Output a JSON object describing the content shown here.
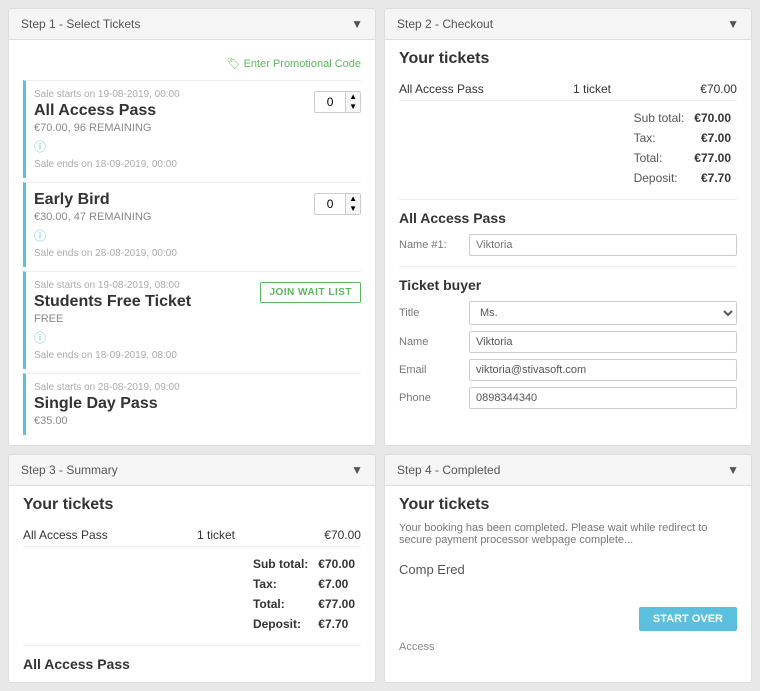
{
  "step1": {
    "header": "Step 1 - Select Tickets",
    "promo_label": "Enter Promotional Code",
    "tickets": [
      {
        "sale_start": "Sale starts on 19-08-2019, 00:00",
        "name": "All Access Pass",
        "price": "€70.00, 96 REMAINING",
        "sale_end": "Sale ends on 18-09-2019, 00:00",
        "qty": "0",
        "type": "qty"
      },
      {
        "sale_start": "",
        "name": "Early Bird",
        "price": "€30.00, 47 REMAINING",
        "sale_end": "Sale ends on 28-08-2019, 00:00",
        "qty": "0",
        "type": "qty"
      },
      {
        "sale_start": "Sale starts on 19-08-2019, 08:00",
        "name": "Students Free Ticket",
        "price": "FREE",
        "sale_end": "Sale ends on 18-09-2019, 08:00",
        "qty": "",
        "type": "waitlist",
        "waitlist_label": "JOIN WAIT LIST"
      },
      {
        "sale_start": "Sale starts on 28-08-2019, 09:00",
        "name": "Single Day Pass",
        "price": "€35.00",
        "sale_end": "",
        "qty": "",
        "type": "none"
      }
    ]
  },
  "step2": {
    "header": "Step 2 - Checkout",
    "your_tickets": "Your tickets",
    "ticket_name": "All Access Pass",
    "ticket_count": "1 ticket",
    "ticket_price": "€70.00",
    "sub_total_label": "Sub total:",
    "sub_total_value": "€70.00",
    "tax_label": "Tax:",
    "tax_value": "€7.00",
    "total_label": "Total:",
    "total_value": "€77.00",
    "deposit_label": "Deposit:",
    "deposit_value": "€7.70",
    "all_access_section": "All Access Pass",
    "name_label": "Name #1:",
    "name_placeholder": "Viktoria",
    "ticket_buyer_section": "Ticket buyer",
    "title_label": "Title",
    "title_value": "Ms.",
    "name_field_label": "Name",
    "name_field_value": "Viktoria",
    "email_label": "Email",
    "email_value": "viktoria@stivasoft.com",
    "phone_label": "Phone",
    "phone_value": "0898344340"
  },
  "step3": {
    "header": "Step 3 - Summary",
    "your_tickets": "Your tickets",
    "ticket_name": "All Access Pass",
    "ticket_count": "1 ticket",
    "ticket_price": "€70.00",
    "sub_total_label": "Sub total:",
    "sub_total_value": "€70.00",
    "tax_label": "Tax:",
    "tax_value": "€7.00",
    "total_label": "Total:",
    "total_value": "€77.00",
    "deposit_label": "Deposit:",
    "deposit_value": "€7.70",
    "all_access_section": "All Access Pass"
  },
  "step4": {
    "header": "Step 4 - Completed",
    "your_tickets": "Your tickets",
    "message": "Your booking has been completed. Please wait while redirect to secure payment processor webpage complete...",
    "start_over": "START OVER",
    "comp_ered": "Comp Ered",
    "access": "Access"
  }
}
